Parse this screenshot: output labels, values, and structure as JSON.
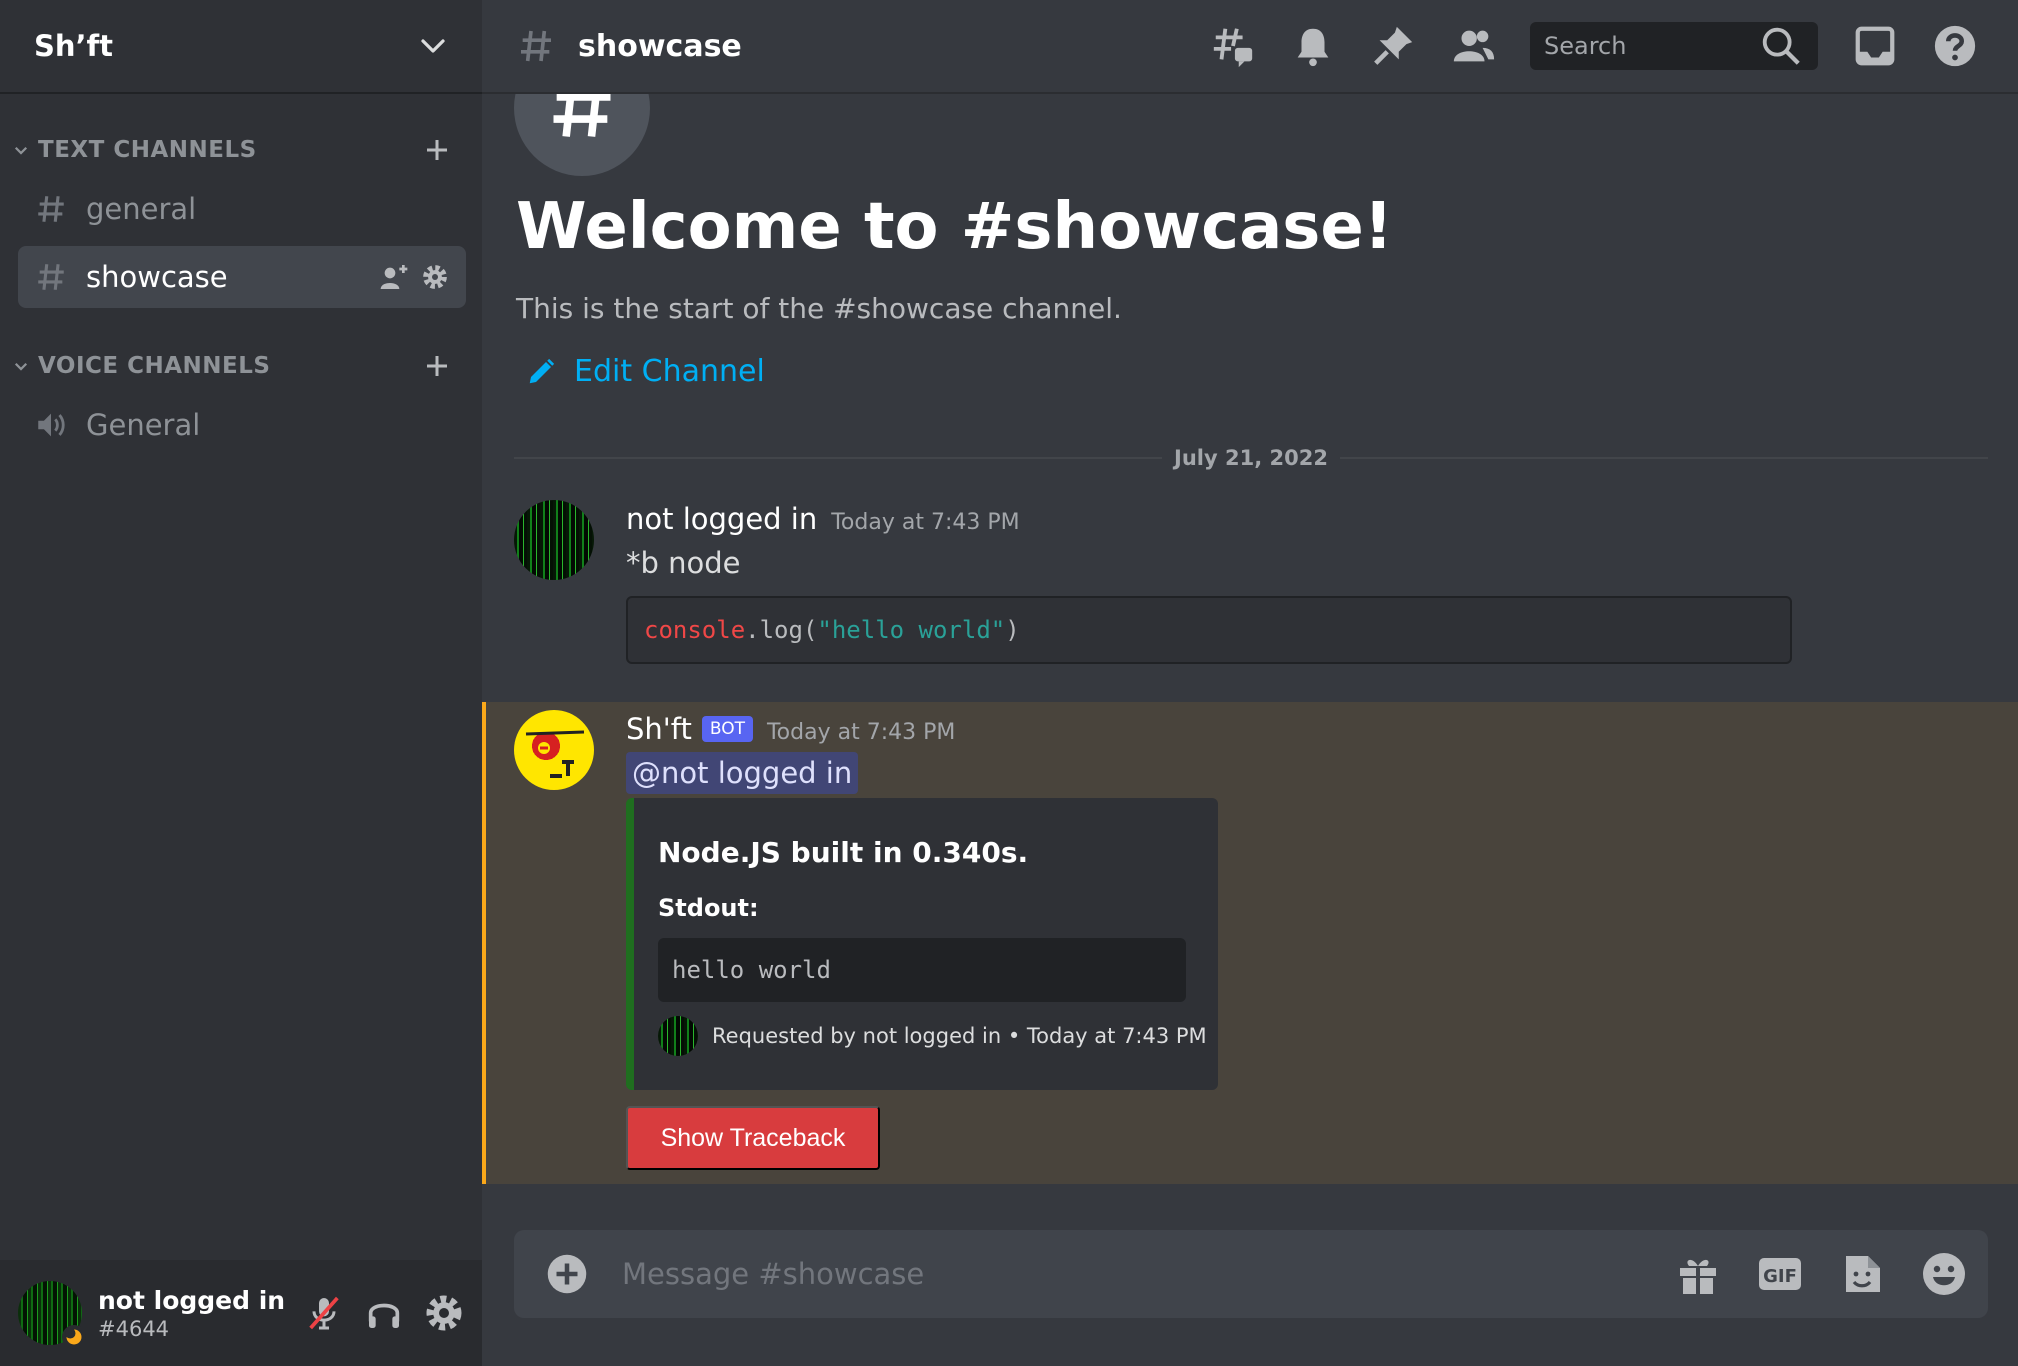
{
  "server": {
    "name": "Sh’ft"
  },
  "sidebar": {
    "text_category": "TEXT CHANNELS",
    "voice_category": "VOICE CHANNELS",
    "text_channels": [
      {
        "label": "general",
        "active": false
      },
      {
        "label": "showcase",
        "active": true
      }
    ],
    "voice_channels": [
      {
        "label": "General"
      }
    ]
  },
  "user": {
    "name": "not logged in",
    "tag": "#4644"
  },
  "topbar": {
    "channel": "showcase",
    "search_placeholder": "Search"
  },
  "welcome": {
    "title": "Welcome to #showcase!",
    "subtitle": "This is the start of the #showcase channel.",
    "edit_label": "Edit Channel"
  },
  "date_divider": "July 21, 2022",
  "messages": [
    {
      "author": "not logged in",
      "time": "Today at 7:43 PM",
      "text": "*b node",
      "code": {
        "t1": "console",
        "t2": ".log(",
        "t3": "\"hello world\"",
        "t4": ")"
      }
    },
    {
      "author": "Sh'ft",
      "badge": "BOT",
      "time": "Today at 7:43 PM",
      "mention": "@not logged in",
      "embed": {
        "title": "Node.JS built in 0.340s.",
        "field_name": "Stdout:",
        "field_value": "hello world",
        "footer": "Requested by not logged in • Today at 7:43 PM"
      },
      "button": "Show Traceback"
    }
  ],
  "composer": {
    "placeholder": "Message #showcase",
    "gif_label": "GIF"
  },
  "colors": {
    "accent_link": "#00aff4",
    "bot_badge": "#5865f2",
    "mention_highlight": "#faa81a",
    "danger": "#d83c3e"
  }
}
